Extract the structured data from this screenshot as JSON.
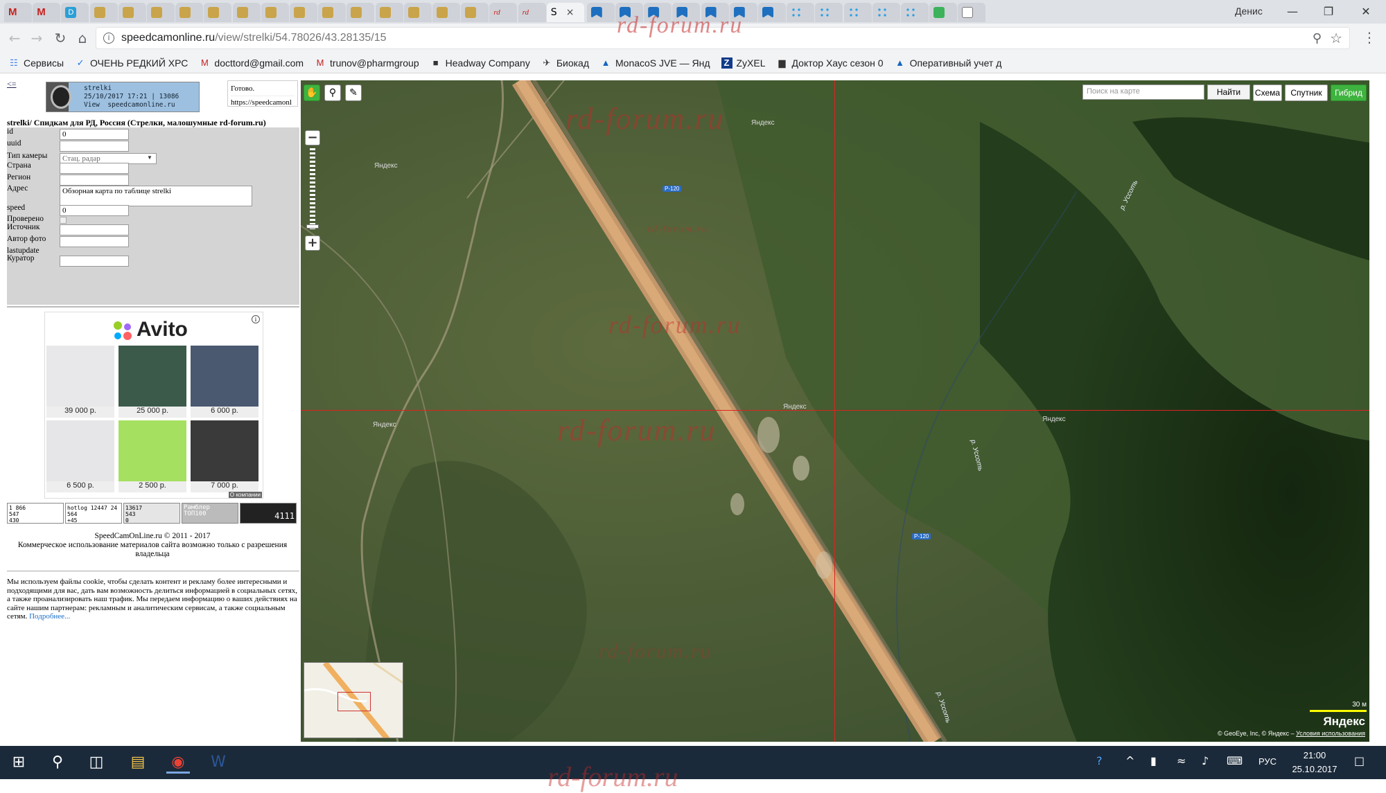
{
  "browser": {
    "user": "Денис",
    "tabs": [
      {
        "icon": "gmail-icon",
        "kind": "mail",
        "letter": "M"
      },
      {
        "icon": "gmail-icon",
        "kind": "mail",
        "letter": "M"
      },
      {
        "icon": "d-icon",
        "kind": "d",
        "letter": "D"
      },
      {
        "icon": "emblem-icon",
        "kind": "emb"
      },
      {
        "icon": "emblem-icon",
        "kind": "emb"
      },
      {
        "icon": "emblem-icon",
        "kind": "emb"
      },
      {
        "icon": "emblem-icon",
        "kind": "emb"
      },
      {
        "icon": "emblem-icon",
        "kind": "emb"
      },
      {
        "icon": "emblem-icon",
        "kind": "emb"
      },
      {
        "icon": "emblem-icon",
        "kind": "emb"
      },
      {
        "icon": "emblem-icon",
        "kind": "emb"
      },
      {
        "icon": "emblem-icon",
        "kind": "emb"
      },
      {
        "icon": "emblem-icon",
        "kind": "emb"
      },
      {
        "icon": "emblem-icon",
        "kind": "emb"
      },
      {
        "icon": "emblem-icon",
        "kind": "emb"
      },
      {
        "icon": "emblem-icon",
        "kind": "emb"
      },
      {
        "icon": "emblem-icon",
        "kind": "emb"
      },
      {
        "icon": "rd-icon",
        "kind": "rd",
        "letter": "rd"
      },
      {
        "icon": "rd-icon",
        "kind": "rd",
        "letter": "rd"
      },
      {
        "icon": "speedcam-icon",
        "kind": "active",
        "letter": "S"
      },
      {
        "icon": "bookmark-flag-icon",
        "kind": "flag"
      },
      {
        "icon": "bookmark-flag-icon",
        "kind": "flag"
      },
      {
        "icon": "bookmark-flag-icon",
        "kind": "flag"
      },
      {
        "icon": "bookmark-flag-icon",
        "kind": "flag"
      },
      {
        "icon": "bookmark-flag-icon",
        "kind": "flag"
      },
      {
        "icon": "bookmark-flag-icon",
        "kind": "flag"
      },
      {
        "icon": "bookmark-flag-icon",
        "kind": "flag"
      },
      {
        "icon": "gear-icon",
        "kind": "dots"
      },
      {
        "icon": "dots-icon",
        "kind": "dots"
      },
      {
        "icon": "dots-icon",
        "kind": "dots"
      },
      {
        "icon": "dots-icon",
        "kind": "dots"
      },
      {
        "icon": "dots-icon",
        "kind": "dots"
      },
      {
        "icon": "green-icon",
        "kind": "green"
      },
      {
        "icon": "doc-icon",
        "kind": "doc"
      }
    ],
    "url_host": "speedcamonline.ru",
    "url_path": "/view/strelki/54.78026/43.28135/15",
    "bookmarks": [
      {
        "icon": "apps-icon",
        "label": "Сервисы"
      },
      {
        "icon": "v-icon",
        "label": "ОЧЕНЬ РЕДКИЙ ХРС"
      },
      {
        "icon": "gmail-icon",
        "label": "docttord@gmail.com"
      },
      {
        "icon": "gmail-icon",
        "label": "trunov@pharmgroup"
      },
      {
        "icon": "hw-icon",
        "label": "Headway Company"
      },
      {
        "icon": "biocad-icon",
        "label": "Биокад"
      },
      {
        "icon": "monacos-icon",
        "label": "MonacoS JVE — Янд"
      },
      {
        "icon": "zyxel-icon",
        "label": "ZyXEL"
      },
      {
        "icon": "film-icon",
        "label": "Доктор Хаус сезон 0"
      },
      {
        "icon": "monacos-icon",
        "label": "Оперативный учет д"
      }
    ]
  },
  "watermark": "rd-forum.ru",
  "left": {
    "back": "<=",
    "logo_text": "strelki\n25/10/2017 17:21 | 13086\nView  speedcamonline.ru",
    "status": [
      "Готово.",
      "https://speedcamonl"
    ],
    "form_title": "strelki/ Спидкам для РД, Россия (Стрелки, малошумные rd-forum.ru)",
    "fields": [
      {
        "label": "id",
        "value": "0",
        "kind": "input"
      },
      {
        "label": "uuid",
        "value": "",
        "kind": "input"
      },
      {
        "label": "Тип камеры",
        "value": "Стац. радар",
        "kind": "select"
      },
      {
        "label": "Страна",
        "value": "",
        "kind": "input"
      },
      {
        "label": "Регион",
        "value": "",
        "kind": "input"
      },
      {
        "label": "Адрес",
        "value": "Обзорная карта по таблице strelki",
        "kind": "textarea"
      },
      {
        "label": "speed",
        "value": "0",
        "kind": "input"
      },
      {
        "label": "Проверено",
        "value": "",
        "kind": "checkbox"
      },
      {
        "label": "Источник",
        "value": "",
        "kind": "input"
      },
      {
        "label": "Автор фото",
        "value": "",
        "kind": "input"
      },
      {
        "label": "lastupdate",
        "value": "",
        "kind": "none"
      },
      {
        "label": "Куратор",
        "value": "",
        "kind": "input"
      }
    ],
    "avito": {
      "brand": "Avito",
      "info": "i",
      "company": "О компании",
      "items": [
        {
          "price": "39 000 р.",
          "color": "#e8e8ea"
        },
        {
          "price": "25 000 р.",
          "color": "#3b5a4a"
        },
        {
          "price": "6 000 р.",
          "color": "#4a5870"
        },
        {
          "price": "6 500 р.",
          "color": "#e6e6e8"
        },
        {
          "price": "2 500 р.",
          "color": "#a6e060"
        },
        {
          "price": "7 000 р.",
          "color": "#3a3a3a"
        }
      ]
    },
    "counters": [
      {
        "text": "1 866\n547\n430",
        "color": "#fff"
      },
      {
        "text": "hotlog 12447 24\n564\n+45",
        "color": "#fff"
      },
      {
        "text": "13617\n543\n0",
        "color": "#e5e5e5"
      },
      {
        "text": "Рамблер\nТОП100",
        "color": "#bbb"
      },
      {
        "text": "4111",
        "color": "#222"
      }
    ],
    "footer_line1": "SpeedCamOnLine.ru © 2011 - 2017",
    "footer_line2": "Коммерческое использование материалов сайта возможно только с разрешения владельца",
    "cookie_text": "Мы используем файлы cookie, чтобы сделать контент и рекламу более интересными и подходящими для вас, дать вам возможность делиться информацией в социальных сетях, а также проанализировать наш трафик. Мы передаем информацию о ваших действиях на сайте нашим партнерам: рекламным и аналитическим сервисам, а также социальным сетям.",
    "cookie_more": "Подробнее..."
  },
  "map": {
    "search_placeholder": "Поиск на карте",
    "search_button": "Найти",
    "types": [
      {
        "label": "Схема",
        "active": false
      },
      {
        "label": "Спутник",
        "active": false
      },
      {
        "label": "Гибрид",
        "active": true
      }
    ],
    "road_label": "Р-120",
    "yandex_label": "Яндекс",
    "river_label": "р. Уссоть",
    "scale": "30 м",
    "logo": "Яндекс",
    "copyright": "© GeoEye, Inc, © Яндекс –",
    "terms": "Условия использования"
  },
  "taskbar": {
    "lang": "РУС",
    "time": "21:00",
    "date": "25.10.2017"
  }
}
